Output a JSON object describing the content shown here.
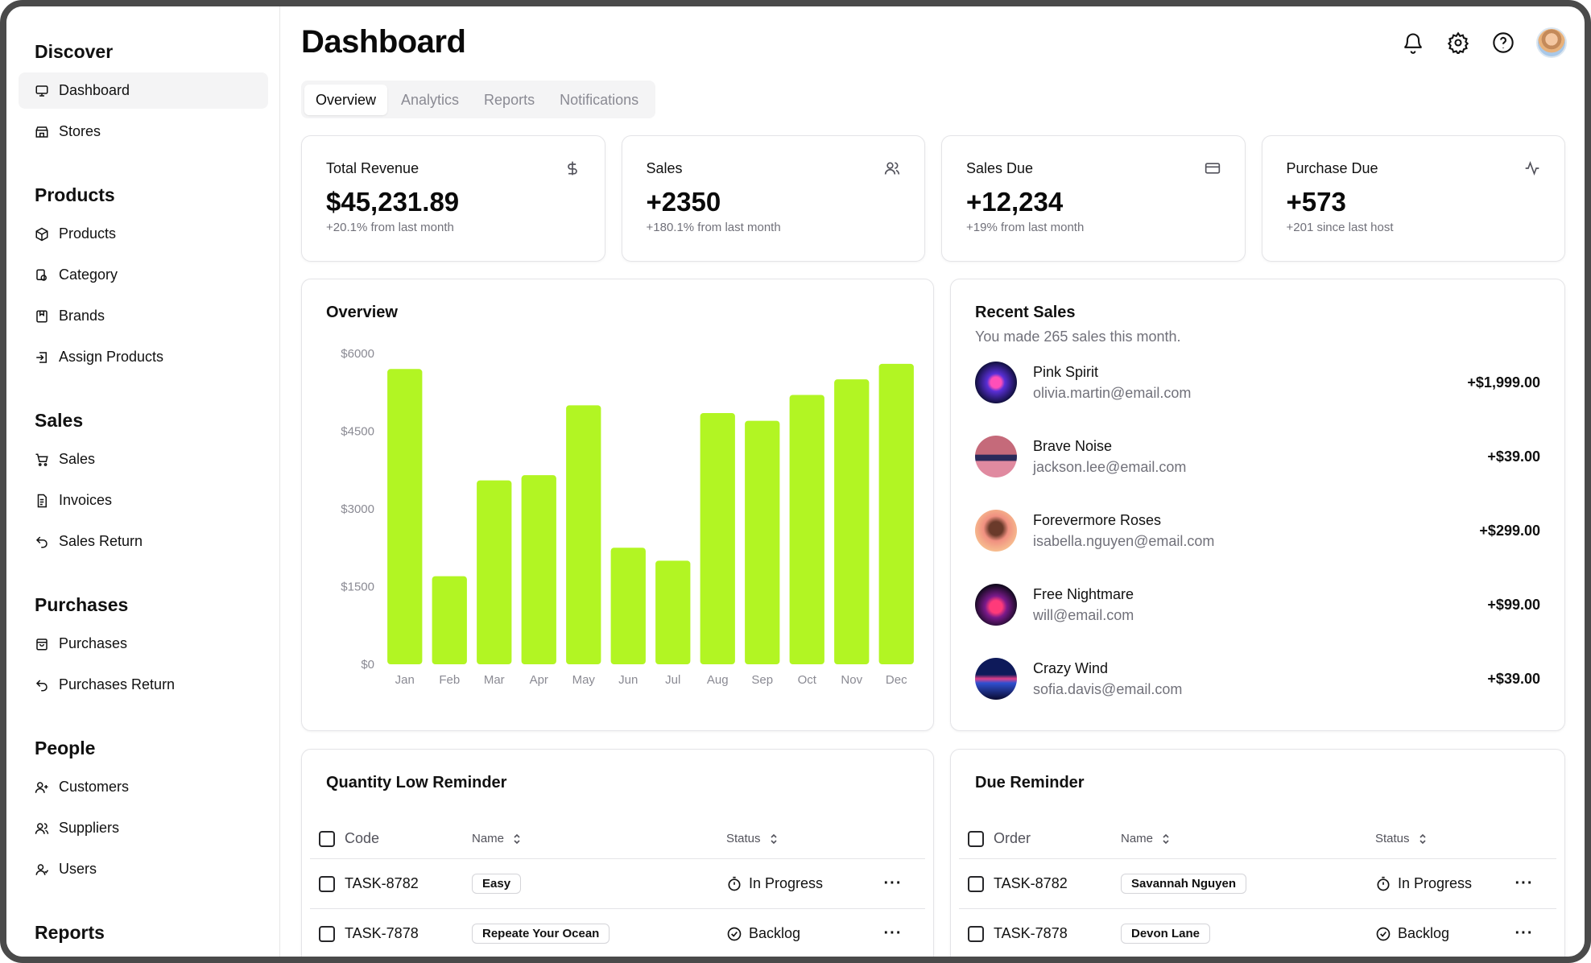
{
  "sidebar": {
    "groups": [
      {
        "heading": "Discover",
        "items": [
          {
            "label": "Dashboard",
            "icon": "monitor-icon"
          },
          {
            "label": "Stores",
            "icon": "store-icon"
          }
        ]
      },
      {
        "heading": "Products",
        "items": [
          {
            "label": "Products",
            "icon": "package-icon"
          },
          {
            "label": "Category",
            "icon": "category-icon"
          },
          {
            "label": "Brands",
            "icon": "bookmark-icon"
          },
          {
            "label": "Assign Products",
            "icon": "assign-icon"
          }
        ]
      },
      {
        "heading": "Sales",
        "items": [
          {
            "label": "Sales",
            "icon": "cart-icon"
          },
          {
            "label": "Invoices",
            "icon": "invoice-icon"
          },
          {
            "label": "Sales Return",
            "icon": "return-icon"
          }
        ]
      },
      {
        "heading": "Purchases",
        "items": [
          {
            "label": "Purchases",
            "icon": "bag-icon"
          },
          {
            "label": "Purchases Return",
            "icon": "return-icon"
          }
        ]
      },
      {
        "heading": "People",
        "items": [
          {
            "label": "Customers",
            "icon": "user-plus-icon"
          },
          {
            "label": "Suppliers",
            "icon": "users-icon"
          },
          {
            "label": "Users",
            "icon": "user-icon"
          }
        ]
      },
      {
        "heading": "Reports",
        "items": []
      }
    ]
  },
  "header": {
    "title": "Dashboard",
    "icons": [
      "bell-icon",
      "gear-icon",
      "help-icon",
      "avatar"
    ]
  },
  "tabs": [
    {
      "label": "Overview",
      "active": true
    },
    {
      "label": "Analytics",
      "active": false
    },
    {
      "label": "Reports",
      "active": false
    },
    {
      "label": "Notifications",
      "active": false
    }
  ],
  "stats": [
    {
      "label": "Total Revenue",
      "value": "$45,231.89",
      "sub": "+20.1% from last month",
      "icon": "dollar-icon"
    },
    {
      "label": "Sales",
      "value": "+2350",
      "sub": "+180.1% from last month",
      "icon": "users-icon"
    },
    {
      "label": "Sales Due",
      "value": "+12,234",
      "sub": "+19% from last month",
      "icon": "credit-card-icon"
    },
    {
      "label": "Purchase Due",
      "value": "+573",
      "sub": "+201 since last host",
      "icon": "activity-icon"
    }
  ],
  "overview": {
    "title": "Overview"
  },
  "chart_data": {
    "type": "bar",
    "title": "Overview",
    "categories": [
      "Jan",
      "Feb",
      "Mar",
      "Apr",
      "May",
      "Jun",
      "Jul",
      "Aug",
      "Sep",
      "Oct",
      "Nov",
      "Dec"
    ],
    "values": [
      5700,
      1700,
      3550,
      3650,
      5000,
      2250,
      2000,
      4850,
      4700,
      5200,
      5500,
      5800
    ],
    "ytick_labels": [
      "$6000",
      "$4500",
      "$3000",
      "$1500",
      "$0"
    ],
    "ytick_values": [
      6000,
      4500,
      3000,
      1500,
      0
    ],
    "ylim": [
      0,
      6000
    ],
    "bar_color": "#b2f523",
    "grid": false
  },
  "recent": {
    "title": "Recent Sales",
    "desc": "You made 265 sales this month.",
    "items": [
      {
        "name": "Pink Spirit",
        "email": "olivia.martin@email.com",
        "amount": "+$1,999.00"
      },
      {
        "name": "Brave Noise",
        "email": "jackson.lee@email.com",
        "amount": "+$39.00"
      },
      {
        "name": "Forevermore Roses",
        "email": "isabella.nguyen@email.com",
        "amount": "+$299.00"
      },
      {
        "name": "Free Nightmare",
        "email": "will@email.com",
        "amount": "+$99.00"
      },
      {
        "name": "Crazy Wind",
        "email": "sofia.davis@email.com",
        "amount": "+$39.00"
      }
    ]
  },
  "qty_reminder": {
    "title": "Quantity Low Reminder",
    "columns": [
      "Code",
      "Name",
      "Status"
    ],
    "rows": [
      {
        "code": "TASK-8782",
        "name": "Easy",
        "status": "In Progress",
        "status_icon": "timer-icon"
      },
      {
        "code": "TASK-7878",
        "name": "Repeate Your Ocean",
        "status": "Backlog",
        "status_icon": "check-circle-icon"
      }
    ]
  },
  "due_reminder": {
    "title": "Due Reminder",
    "columns": [
      "Order",
      "Name",
      "Status"
    ],
    "rows": [
      {
        "code": "TASK-8782",
        "name": "Savannah Nguyen",
        "status": "In Progress",
        "status_icon": "timer-icon"
      },
      {
        "code": "TASK-7878",
        "name": "Devon Lane",
        "status": "Backlog",
        "status_icon": "check-circle-icon"
      }
    ]
  },
  "colors": {
    "accent": "#b2f523",
    "muted": "#71717a",
    "border": "#e4e4e7"
  }
}
